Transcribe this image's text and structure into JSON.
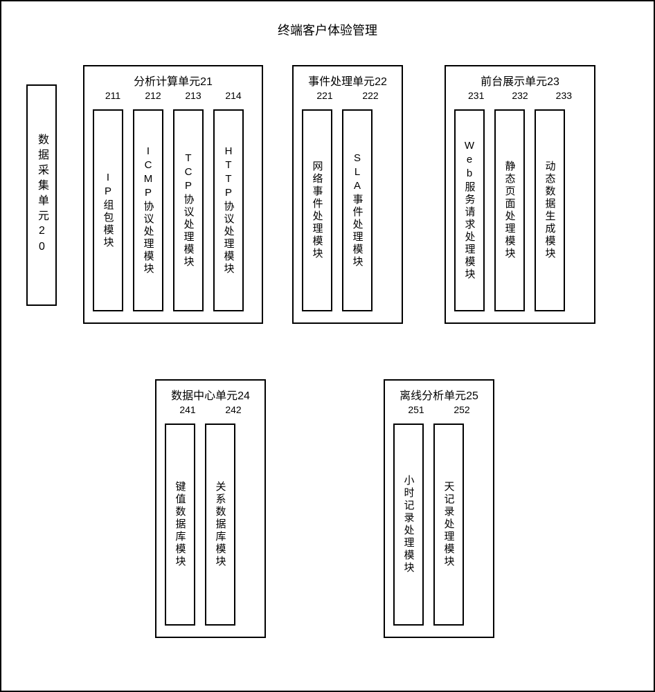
{
  "title": "终端客户体验管理",
  "data_collect": "数据采集单元20",
  "units": {
    "u21": {
      "title": "分析计算单元21",
      "mods": [
        {
          "num": "211",
          "label": "IP组包模块"
        },
        {
          "num": "212",
          "label": "ICMP协议处理模块"
        },
        {
          "num": "213",
          "label": "TCP协议处理模块"
        },
        {
          "num": "214",
          "label": "HTTP协议处理模块"
        }
      ]
    },
    "u22": {
      "title": "事件处理单元22",
      "mods": [
        {
          "num": "221",
          "label": "网络事件处理模块"
        },
        {
          "num": "222",
          "label": "SLA事件处理模块"
        }
      ]
    },
    "u23": {
      "title": "前台展示单元23",
      "mods": [
        {
          "num": "231",
          "label": "Web服务请求处理模块"
        },
        {
          "num": "232",
          "label": "静态页面处理模块"
        },
        {
          "num": "233",
          "label": "动态数据生成模块"
        }
      ]
    },
    "u24": {
      "title": "数据中心单元24",
      "mods": [
        {
          "num": "241",
          "label": "键值数据库模块"
        },
        {
          "num": "242",
          "label": "关系数据库模块"
        }
      ]
    },
    "u25": {
      "title": "离线分析单元25",
      "mods": [
        {
          "num": "251",
          "label": "小时记录处理模块"
        },
        {
          "num": "252",
          "label": "天记录处理模块"
        }
      ]
    }
  }
}
